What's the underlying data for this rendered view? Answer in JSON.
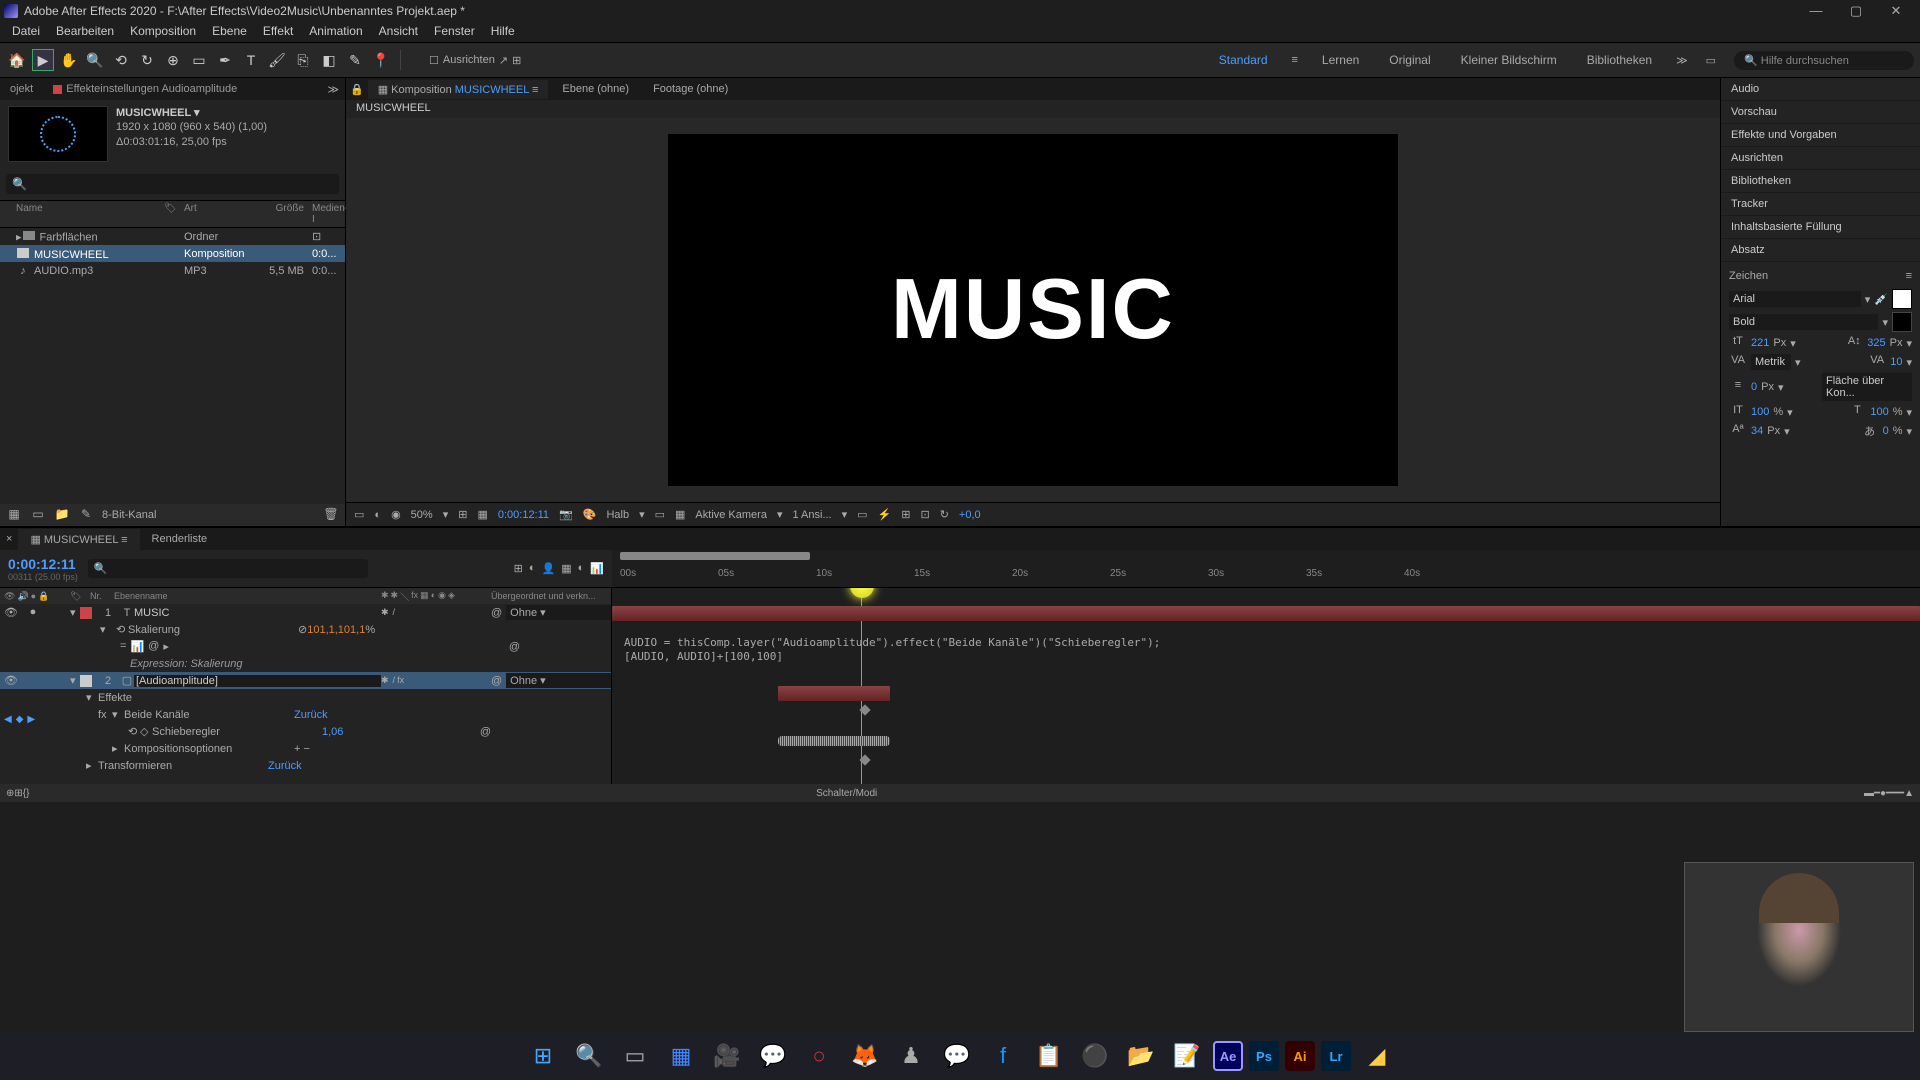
{
  "window": {
    "title": "Adobe After Effects 2020 - F:\\After Effects\\Video2Music\\Unbenanntes Projekt.aep *",
    "min": "—",
    "max": "▢",
    "close": "✕"
  },
  "menu": [
    "Datei",
    "Bearbeiten",
    "Komposition",
    "Ebene",
    "Effekt",
    "Animation",
    "Ansicht",
    "Fenster",
    "Hilfe"
  ],
  "toolbar": {
    "snap": "Ausrichten",
    "workspaces": [
      "Standard",
      "Lernen",
      "Original",
      "Kleiner Bildschirm",
      "Bibliotheken"
    ],
    "search": "Hilfe durchsuchen"
  },
  "project": {
    "tab": "ojekt",
    "fx_tab": "Effekteinstellungen Audioamplitude",
    "comp_name": "MUSICWHEEL",
    "comp_dims": "1920 x 1080 (960 x 540) (1,00)",
    "comp_dur": "Δ0:03:01:16, 25,00 fps",
    "cols": {
      "name": "Name",
      "art": "Art",
      "size": "Größe",
      "media": "Medien-I"
    },
    "rows": [
      {
        "name": "Farbflächen",
        "art": "Ordner",
        "size": "",
        "media": "",
        "label": "#888"
      },
      {
        "name": "MUSICWHEEL",
        "art": "Komposition",
        "size": "",
        "media": "0:0...",
        "label": "#c9a85a",
        "selected": true
      },
      {
        "name": "AUDIO.mp3",
        "art": "MP3",
        "size": "5,5 MB",
        "media": "0:0...",
        "label": "#888"
      }
    ],
    "footer_bit": "8-Bit-Kanal"
  },
  "viewer": {
    "tabs": {
      "comp_prefix": "Komposition",
      "comp_name": "MUSICWHEEL",
      "ebene": "Ebene (ohne)",
      "footage": "Footage (ohne)"
    },
    "breadcrumb": "MUSICWHEEL",
    "canvas_text": "MUSIC",
    "footer": {
      "zoom": "50%",
      "time": "0:00:12:11",
      "res": "Halb",
      "camera": "Aktive Kamera",
      "views": "1 Ansi...",
      "exp": "+0,0"
    }
  },
  "right_panels": [
    "Audio",
    "Vorschau",
    "Effekte und Vorgaben",
    "Ausrichten",
    "Bibliotheken",
    "Tracker",
    "Inhaltsbasierte Füllung",
    "Absatz"
  ],
  "char": {
    "title": "Zeichen",
    "font": "Arial",
    "weight": "Bold",
    "size": "221",
    "size_unit": "Px",
    "leading": "325",
    "leading_unit": "Px",
    "kerning": "Metrik",
    "tracking": "10",
    "stroke": "0",
    "stroke_unit": "Px",
    "stroke_mode": "Fläche über Kon...",
    "vscale": "100",
    "hscale": "100",
    "pct": "%",
    "baseline": "34",
    "baseline_unit": "Px",
    "tsume": "0"
  },
  "timeline": {
    "tab": "MUSICWHEEL",
    "renderlist": "Renderliste",
    "current_time": "0:00:12:11",
    "frame_info": "00311 (25.00 fps)",
    "ruler": [
      "00s",
      "05s",
      "10s",
      "15s",
      "20s",
      "25s",
      "30s",
      "35s",
      "40s"
    ],
    "cols": {
      "nr": "Nr.",
      "name": "Ebenenname",
      "parent": "Übergeordnet und verkn..."
    },
    "layers": [
      {
        "nr": "1",
        "name": "MUSIC",
        "type": "T",
        "parent": "Ohne",
        "label": "#c44"
      },
      {
        "nr": "2",
        "name": "[Audioamplitude]",
        "type": "▢",
        "parent": "Ohne",
        "label": "#ccc",
        "selected": true
      }
    ],
    "props": {
      "skalierung": "Skalierung",
      "skal_val": "101,1,101,1",
      "skal_pct": "%",
      "expr_label": "Expression: Skalierung",
      "effekte": "Effekte",
      "beide": "Beide Kanäle",
      "beide_val": "Zurück",
      "schieber": "Schieberegler",
      "schieber_val": "1,06",
      "kompopt": "Kompositionsoptionen",
      "kompopt_icons": "+ −",
      "transform": "Transformieren",
      "transform_val": "Zurück"
    },
    "expression": "AUDIO = thisComp.layer(\"Audioamplitude\").effect(\"Beide Kanäle\")(\"Schieberegler\");\n[AUDIO, AUDIO]+[100,100]",
    "footer": "Schalter/Modi"
  },
  "taskbar": {
    "apps": [
      "⊞",
      "🔍",
      "▭",
      "📋",
      "🎥",
      "💬",
      "🔴",
      "🦊",
      "♟",
      "💬",
      "f",
      "📁",
      "⚫",
      "📂",
      "📝"
    ]
  }
}
